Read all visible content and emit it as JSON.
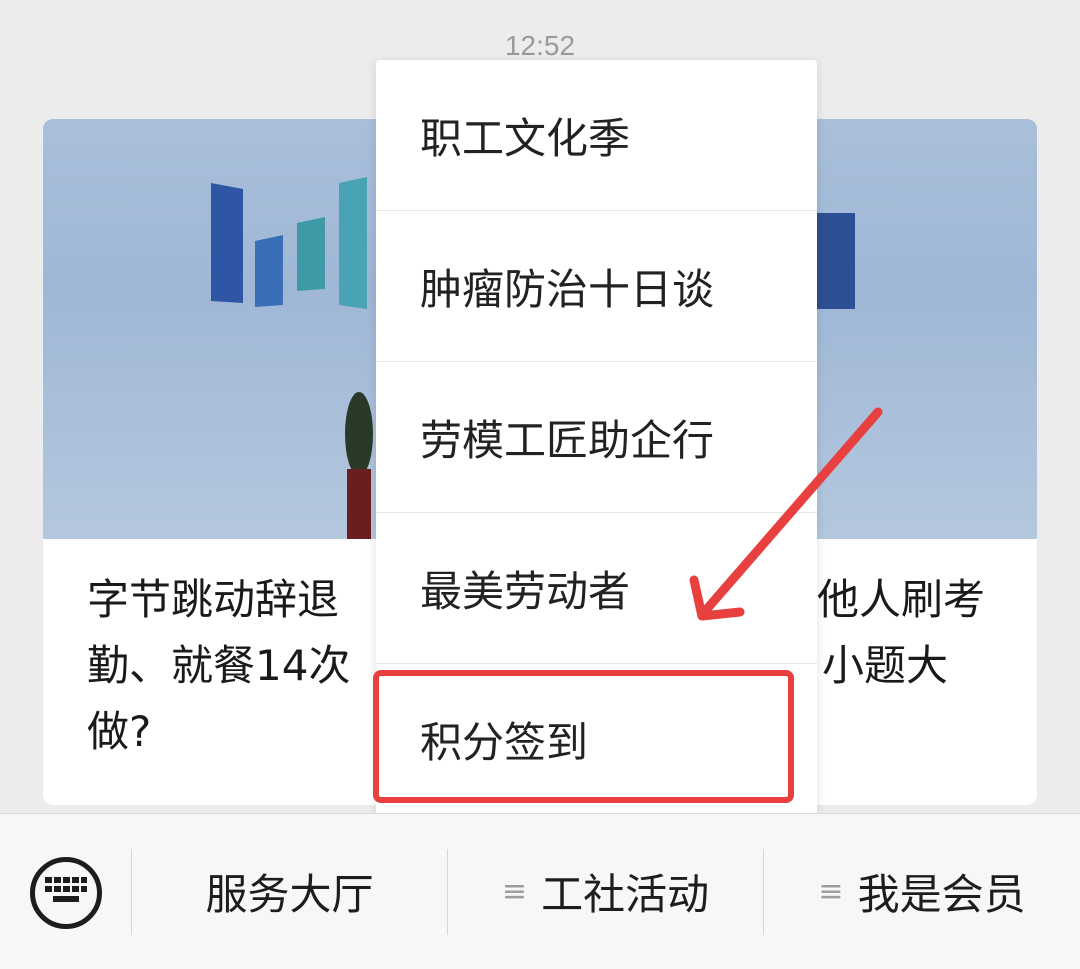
{
  "status": {
    "time": "12:52"
  },
  "card": {
    "title_lines": [
      {
        "left": "字节跳动辞退",
        "right": "他人刷考"
      },
      {
        "left": "勤、就餐14次",
        "right": "小题大"
      },
      {
        "left": "做?",
        "right": ""
      }
    ]
  },
  "menu": {
    "items": [
      "职工文化季",
      "肿瘤防治十日谈",
      "劳模工匠助企行",
      "最美劳动者",
      "积分签到"
    ],
    "highlighted_index": 4
  },
  "annotation": {
    "color": "#e8403e"
  },
  "bottom_bar": {
    "keyboard_icon": "keyboard-icon",
    "tabs": [
      {
        "label": "服务大厅",
        "has_menu_icon": false
      },
      {
        "label": "工社活动",
        "has_menu_icon": true
      },
      {
        "label": "我是会员",
        "has_menu_icon": true
      }
    ],
    "menu_icon_glyph": "≡"
  }
}
